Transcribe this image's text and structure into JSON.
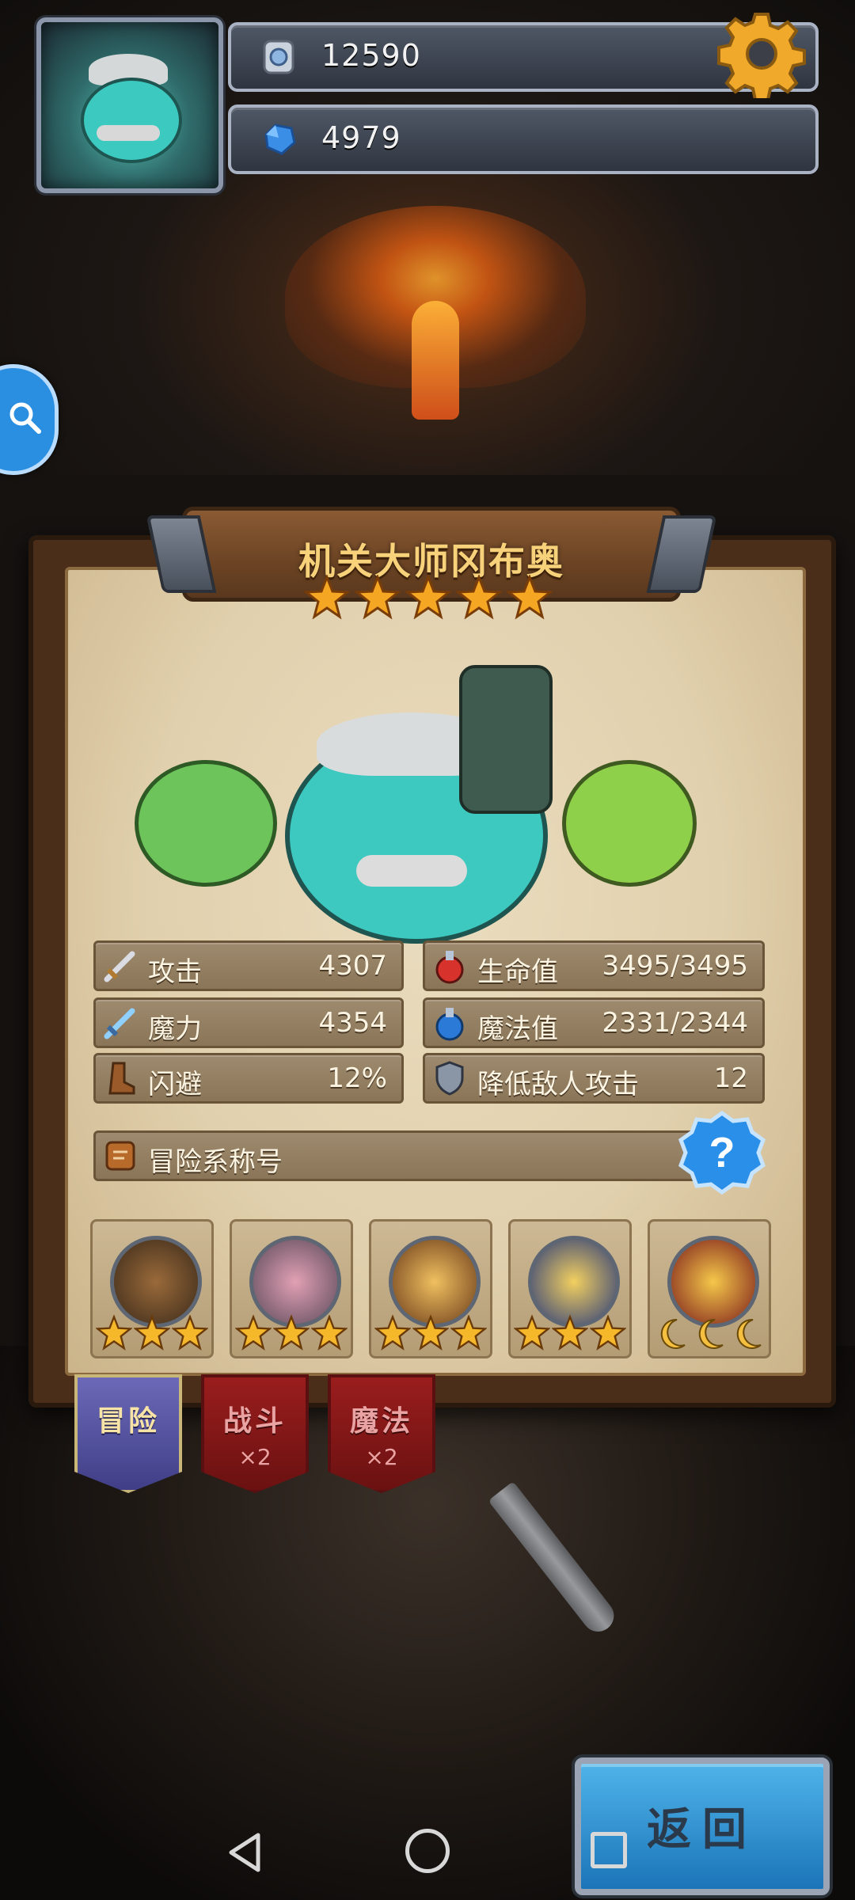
{
  "hud": {
    "silver": "12590",
    "gems": "4979"
  },
  "hero": {
    "name": "机关大师冈布奥",
    "star_count": 5
  },
  "stats": [
    {
      "label": "攻击",
      "value": "4307",
      "icon": "sword-icon"
    },
    {
      "label": "生命值",
      "value": "3495/3495",
      "icon": "red-potion-icon"
    },
    {
      "label": "魔力",
      "value": "4354",
      "icon": "magic-sword-icon"
    },
    {
      "label": "魔法值",
      "value": "2331/2344",
      "icon": "blue-potion-icon"
    },
    {
      "label": "闪避",
      "value": "12%",
      "icon": "boot-icon"
    },
    {
      "label": "降低敌人攻击",
      "value": "12",
      "icon": "shield-icon"
    }
  ],
  "title_bar": {
    "label": "冒险系称号"
  },
  "badges": [
    {
      "name": "telescope-badge",
      "stars": 3
    },
    {
      "name": "knight-badge",
      "stars": 3
    },
    {
      "name": "treasure-badge",
      "stars": 3
    },
    {
      "name": "gold-laurel-badge",
      "stars": 3
    },
    {
      "name": "trophy-badge",
      "moons": 3
    }
  ],
  "tabs": [
    {
      "label": "冒险",
      "multiplier": "",
      "active": true
    },
    {
      "label": "战斗",
      "multiplier": "×2",
      "active": false
    },
    {
      "label": "魔法",
      "multiplier": "×2",
      "active": false
    }
  ],
  "return_button": {
    "label": "返回"
  },
  "colors": {
    "star_gold": "#f5b82a",
    "tab_active": "#4f4ea0",
    "tab_inactive": "#8a1818",
    "return_blue": "#2f8fd0"
  }
}
